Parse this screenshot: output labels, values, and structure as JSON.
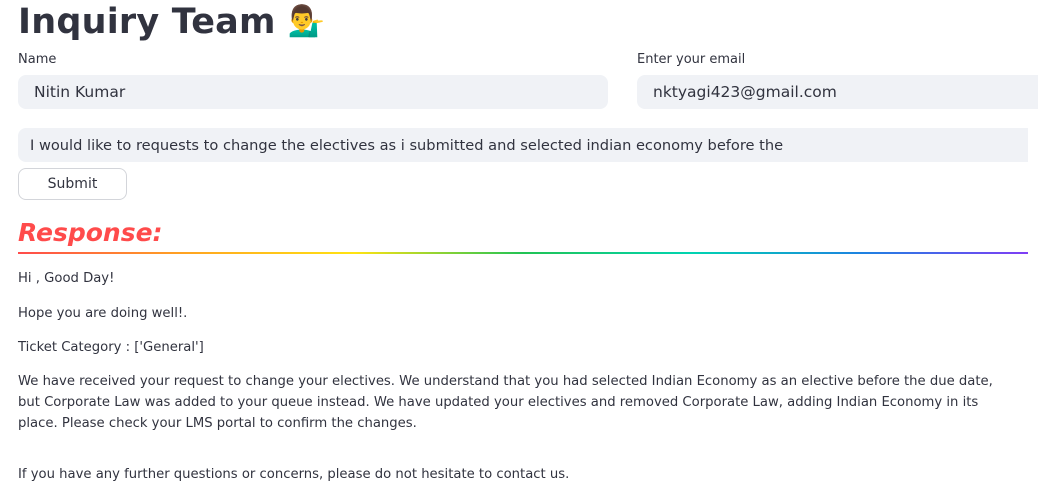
{
  "header": {
    "title": "Inquiry Team",
    "title_emoji": "💁‍♂️"
  },
  "form": {
    "name_label": "Name",
    "name_value": "Nitin Kumar",
    "email_label": "Enter your email",
    "email_value": "nktyagi423@gmail.com",
    "query_value": "I would like to requests to change the electives as i submitted and selected indian economy before the",
    "submit_label": "Submit"
  },
  "response": {
    "heading": "Response:",
    "greeting": "Hi , Good Day!",
    "wellwish": "Hope you are doing well!.",
    "ticket_category": "Ticket Category : ['General']",
    "body": "We have received your request to change your electives. We understand that you had selected Indian Economy as an elective before the due date, but Corporate Law was added to your queue instead. We have updated your electives and removed Corporate Law, adding Indian Economy in its place. Please check your LMS portal to confirm the changes.",
    "closing": "If you have any further questions or concerns, please do not hesitate to contact us."
  },
  "colors": {
    "response_heading": "#ff4b4b",
    "input_background": "#f0f2f6",
    "text": "#31333f"
  }
}
